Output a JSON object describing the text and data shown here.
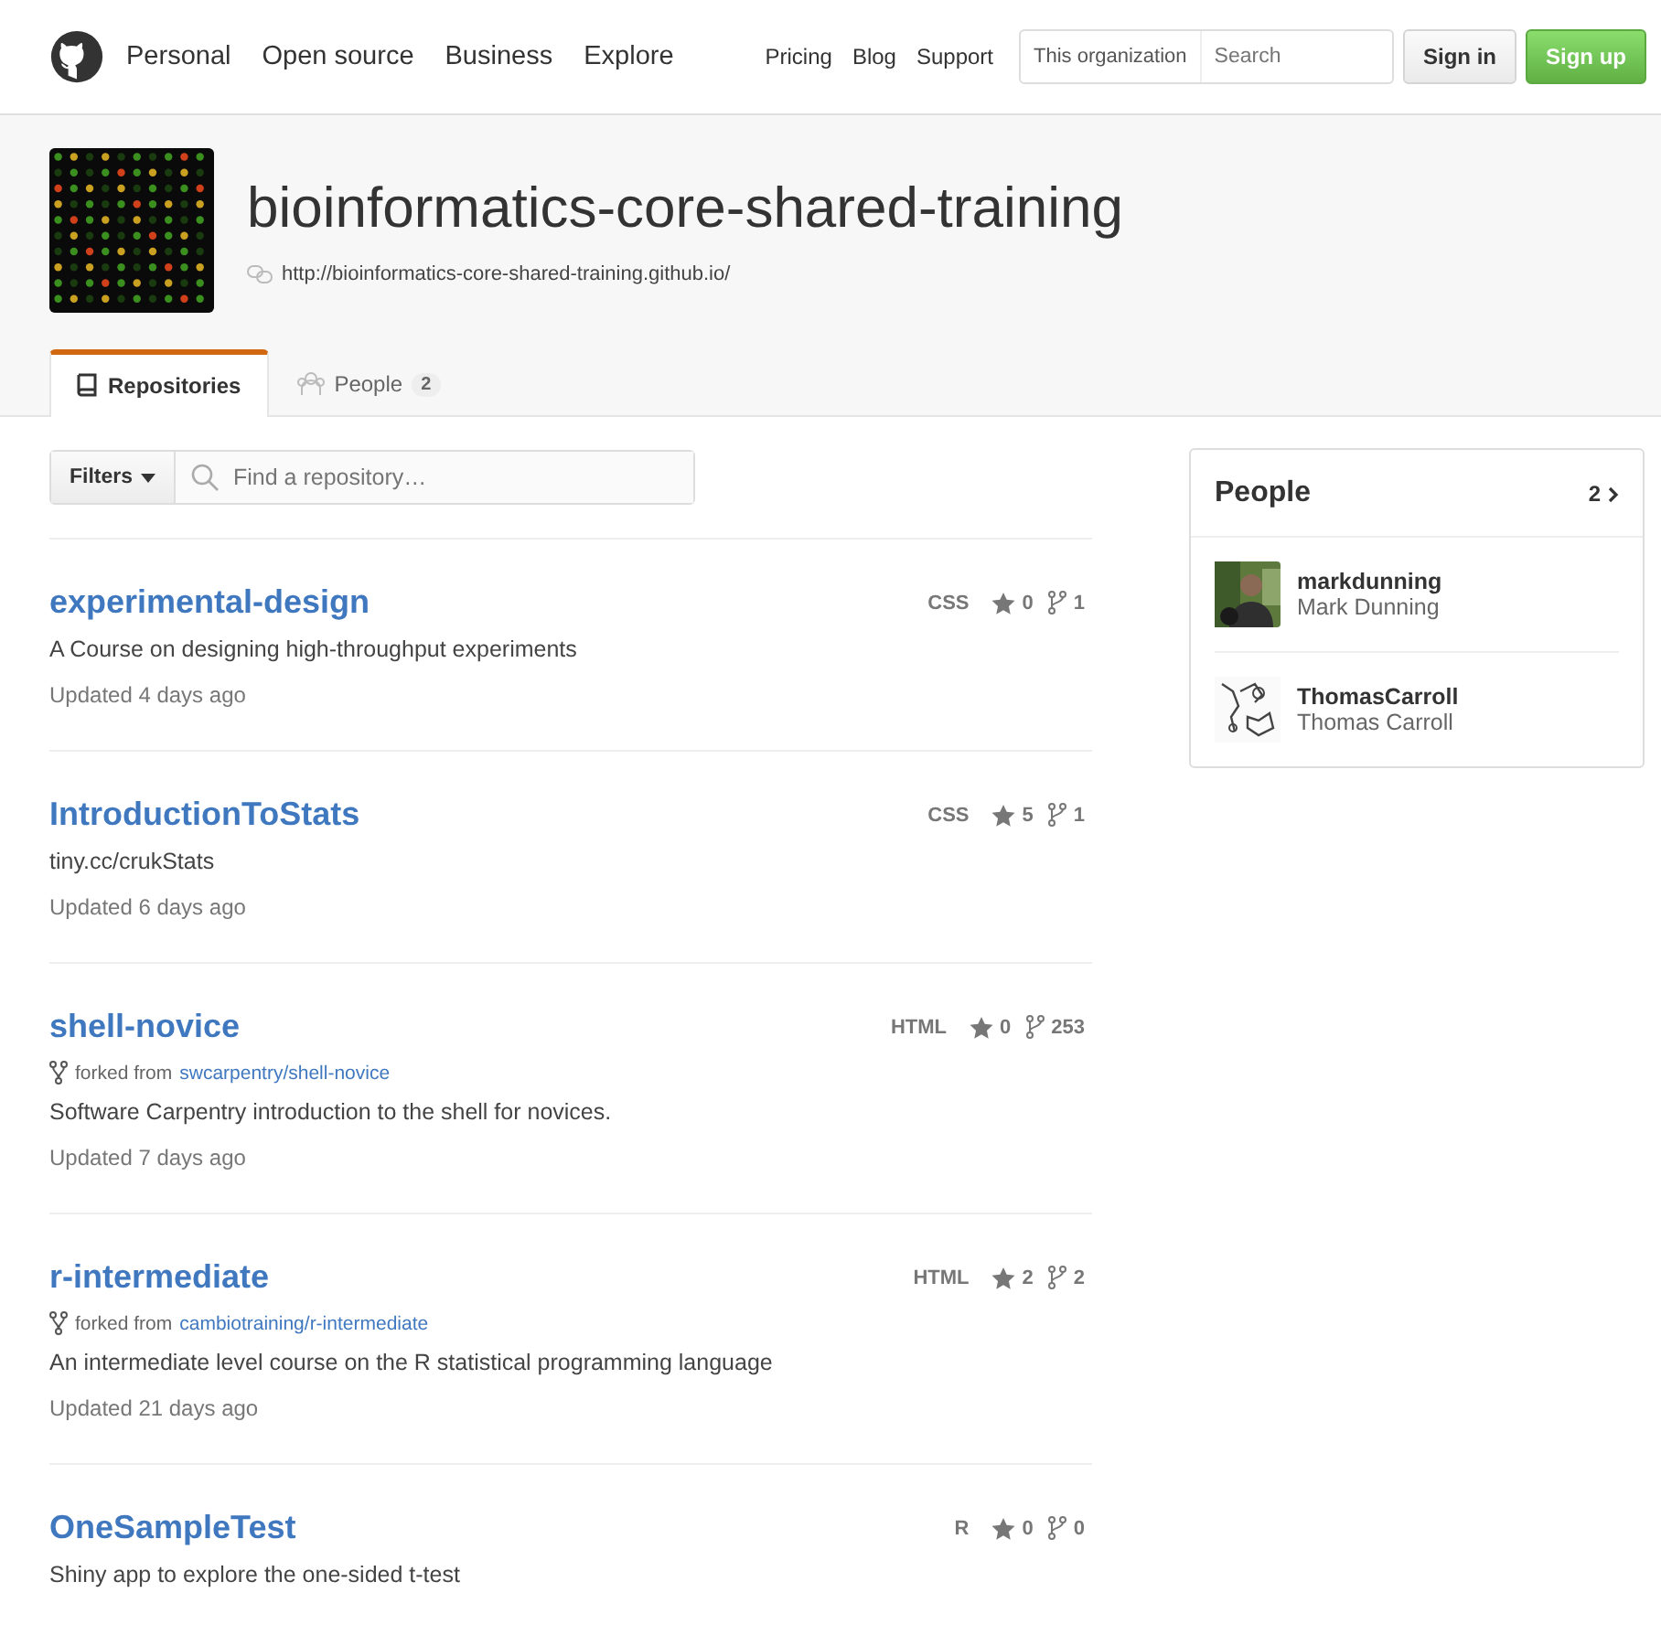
{
  "header": {
    "nav": [
      "Personal",
      "Open source",
      "Business",
      "Explore"
    ],
    "links": [
      "Pricing",
      "Blog",
      "Support"
    ],
    "search_scope": "This organization",
    "search": {
      "placeholder": "Search"
    },
    "sign_in": "Sign in",
    "sign_up": "Sign up"
  },
  "org": {
    "name": "bioinformatics-core-shared-training",
    "url": "http://bioinformatics-core-shared-training.github.io/"
  },
  "tabs": [
    {
      "label": "Repositories",
      "selected": true
    },
    {
      "label": "People",
      "count": "2",
      "selected": false
    }
  ],
  "filters": {
    "button": "Filters",
    "search": {
      "placeholder": "Find a repository…"
    }
  },
  "repos": [
    {
      "name": "experimental-design",
      "language": "CSS",
      "stars": "0",
      "forks": "1",
      "description": "A Course on designing high-throughput experiments",
      "updated": "Updated 4 days ago"
    },
    {
      "name": "IntroductionToStats",
      "language": "CSS",
      "stars": "5",
      "forks": "1",
      "description": "tiny.cc/crukStats",
      "updated": "Updated 6 days ago"
    },
    {
      "name": "shell-novice",
      "language": "HTML",
      "stars": "0",
      "forks": "253",
      "forked_from": "swcarpentry/shell-novice",
      "forked_label": "forked from",
      "description": "Software Carpentry introduction to the shell for novices.",
      "updated": "Updated 7 days ago"
    },
    {
      "name": "r-intermediate",
      "language": "HTML",
      "stars": "2",
      "forks": "2",
      "forked_from": "cambiotraining/r-intermediate",
      "forked_label": "forked from",
      "description": "An intermediate level course on the R statistical programming language",
      "updated": "Updated 21 days ago"
    },
    {
      "name": "OneSampleTest",
      "language": "R",
      "stars": "0",
      "forks": "0",
      "description": "Shiny app to explore the one-sided t-test"
    }
  ],
  "people": {
    "title": "People",
    "count": "2",
    "members": [
      {
        "login": "markdunning",
        "name": "Mark Dunning"
      },
      {
        "login": "ThomasCarroll",
        "name": "Thomas Carroll"
      }
    ]
  }
}
